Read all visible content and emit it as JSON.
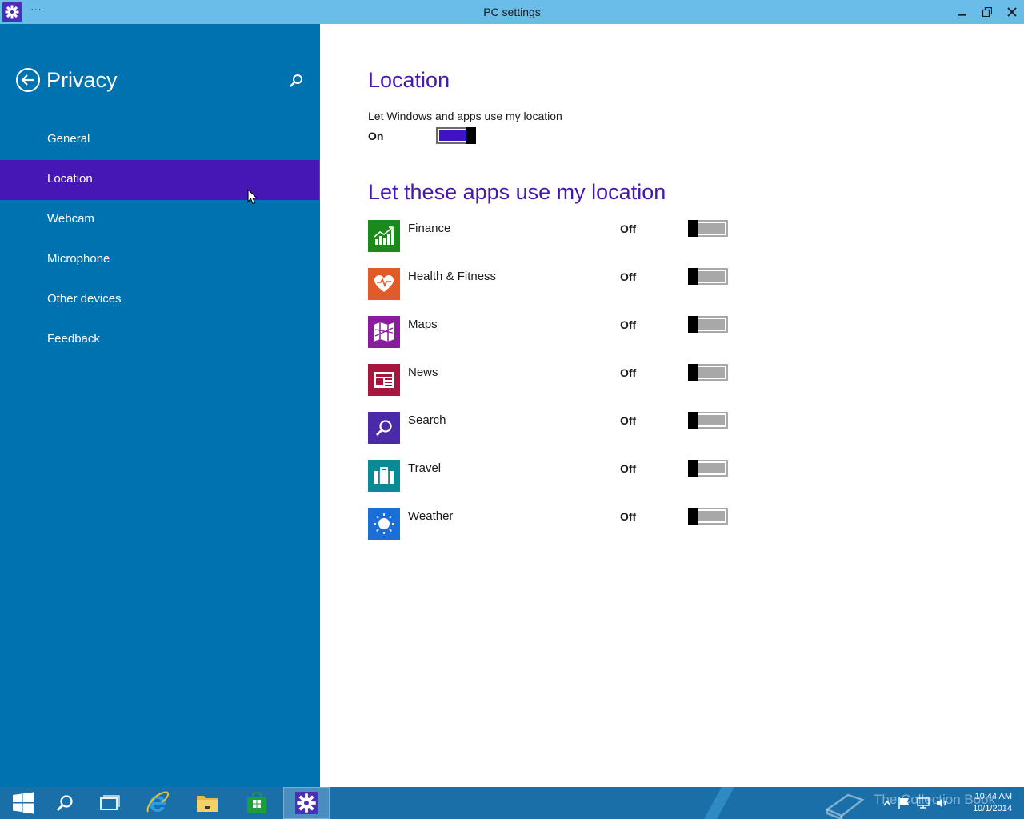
{
  "window": {
    "title": "PC settings",
    "menu_dots": "···"
  },
  "sidebar": {
    "title": "Privacy",
    "items": [
      {
        "label": "General",
        "active": false
      },
      {
        "label": "Location",
        "active": true
      },
      {
        "label": "Webcam",
        "active": false
      },
      {
        "label": "Microphone",
        "active": false
      },
      {
        "label": "Other devices",
        "active": false
      },
      {
        "label": "Feedback",
        "active": false
      }
    ]
  },
  "main": {
    "location_heading": "Location",
    "location_description": "Let Windows and apps use my location",
    "location_state": "On",
    "apps_heading": "Let these apps use my location",
    "apps": [
      {
        "name": "Finance",
        "state": "Off",
        "icon": "finance-icon",
        "color": "#1a8a1a"
      },
      {
        "name": "Health & Fitness",
        "state": "Off",
        "icon": "health-fitness-icon",
        "color": "#e05a2a"
      },
      {
        "name": "Maps",
        "state": "Off",
        "icon": "maps-icon",
        "color": "#8a1a9e"
      },
      {
        "name": "News",
        "state": "Off",
        "icon": "news-icon",
        "color": "#a8163e"
      },
      {
        "name": "Search",
        "state": "Off",
        "icon": "search-app-icon",
        "color": "#4a2aa8"
      },
      {
        "name": "Travel",
        "state": "Off",
        "icon": "travel-icon",
        "color": "#0a8a96"
      },
      {
        "name": "Weather",
        "state": "Off",
        "icon": "weather-icon",
        "color": "#1a6ed8"
      }
    ]
  },
  "taskbar": {
    "watermark": "The Collection Book",
    "time": "10:44 AM",
    "date": "10/1/2014"
  },
  "colors": {
    "accent": "#4617b4",
    "sidebar": "#0072b0",
    "titlebar": "#6bbde9",
    "taskbar": "#1a6fa8"
  }
}
